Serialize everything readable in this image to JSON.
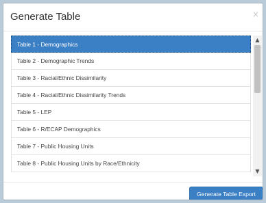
{
  "modal": {
    "title": "Generate Table",
    "close_symbol": "×"
  },
  "tables": [
    {
      "label": "Table 1 - Demographics",
      "selected": true
    },
    {
      "label": "Table 2 - Demographic Trends",
      "selected": false
    },
    {
      "label": "Table 3 - Racial/Ethnic Dissimilarity",
      "selected": false
    },
    {
      "label": "Table 4 - Racial/Ethnic Dissimilarity Trends",
      "selected": false
    },
    {
      "label": "Table 5 - LEP",
      "selected": false
    },
    {
      "label": "Table 6 - R/ECAP Demographics",
      "selected": false
    },
    {
      "label": "Table 7 - Public Housing Units",
      "selected": false
    },
    {
      "label": "Table 8 - Public Housing Units by Race/Ethnicity",
      "selected": false
    }
  ],
  "scrollbar": {
    "up_icon": "chevron-up-icon",
    "down_icon": "chevron-down-icon"
  },
  "footer": {
    "export_label": "Generate Table Export"
  },
  "colors": {
    "selected_bg": "#3b7fc4",
    "button_bg": "#3b7fc4",
    "backdrop": "#b9cbd9"
  }
}
